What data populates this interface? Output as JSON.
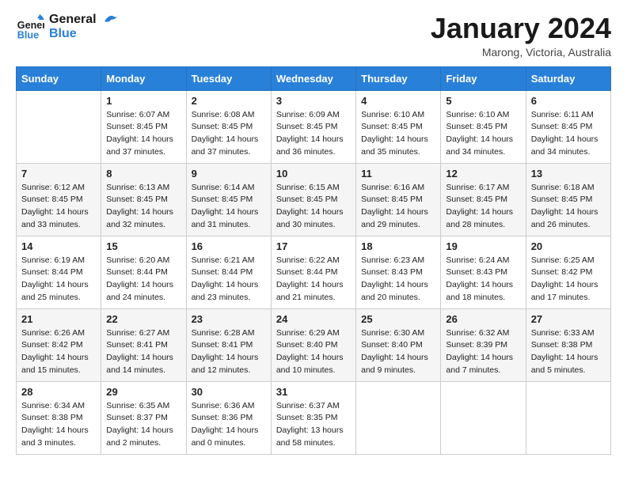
{
  "logo": {
    "line1": "General",
    "line2": "Blue"
  },
  "title": "January 2024",
  "subtitle": "Marong, Victoria, Australia",
  "headers": [
    "Sunday",
    "Monday",
    "Tuesday",
    "Wednesday",
    "Thursday",
    "Friday",
    "Saturday"
  ],
  "weeks": [
    [
      {
        "num": "",
        "detail": ""
      },
      {
        "num": "1",
        "detail": "Sunrise: 6:07 AM\nSunset: 8:45 PM\nDaylight: 14 hours\nand 37 minutes."
      },
      {
        "num": "2",
        "detail": "Sunrise: 6:08 AM\nSunset: 8:45 PM\nDaylight: 14 hours\nand 37 minutes."
      },
      {
        "num": "3",
        "detail": "Sunrise: 6:09 AM\nSunset: 8:45 PM\nDaylight: 14 hours\nand 36 minutes."
      },
      {
        "num": "4",
        "detail": "Sunrise: 6:10 AM\nSunset: 8:45 PM\nDaylight: 14 hours\nand 35 minutes."
      },
      {
        "num": "5",
        "detail": "Sunrise: 6:10 AM\nSunset: 8:45 PM\nDaylight: 14 hours\nand 34 minutes."
      },
      {
        "num": "6",
        "detail": "Sunrise: 6:11 AM\nSunset: 8:45 PM\nDaylight: 14 hours\nand 34 minutes."
      }
    ],
    [
      {
        "num": "7",
        "detail": "Sunrise: 6:12 AM\nSunset: 8:45 PM\nDaylight: 14 hours\nand 33 minutes."
      },
      {
        "num": "8",
        "detail": "Sunrise: 6:13 AM\nSunset: 8:45 PM\nDaylight: 14 hours\nand 32 minutes."
      },
      {
        "num": "9",
        "detail": "Sunrise: 6:14 AM\nSunset: 8:45 PM\nDaylight: 14 hours\nand 31 minutes."
      },
      {
        "num": "10",
        "detail": "Sunrise: 6:15 AM\nSunset: 8:45 PM\nDaylight: 14 hours\nand 30 minutes."
      },
      {
        "num": "11",
        "detail": "Sunrise: 6:16 AM\nSunset: 8:45 PM\nDaylight: 14 hours\nand 29 minutes."
      },
      {
        "num": "12",
        "detail": "Sunrise: 6:17 AM\nSunset: 8:45 PM\nDaylight: 14 hours\nand 28 minutes."
      },
      {
        "num": "13",
        "detail": "Sunrise: 6:18 AM\nSunset: 8:45 PM\nDaylight: 14 hours\nand 26 minutes."
      }
    ],
    [
      {
        "num": "14",
        "detail": "Sunrise: 6:19 AM\nSunset: 8:44 PM\nDaylight: 14 hours\nand 25 minutes."
      },
      {
        "num": "15",
        "detail": "Sunrise: 6:20 AM\nSunset: 8:44 PM\nDaylight: 14 hours\nand 24 minutes."
      },
      {
        "num": "16",
        "detail": "Sunrise: 6:21 AM\nSunset: 8:44 PM\nDaylight: 14 hours\nand 23 minutes."
      },
      {
        "num": "17",
        "detail": "Sunrise: 6:22 AM\nSunset: 8:44 PM\nDaylight: 14 hours\nand 21 minutes."
      },
      {
        "num": "18",
        "detail": "Sunrise: 6:23 AM\nSunset: 8:43 PM\nDaylight: 14 hours\nand 20 minutes."
      },
      {
        "num": "19",
        "detail": "Sunrise: 6:24 AM\nSunset: 8:43 PM\nDaylight: 14 hours\nand 18 minutes."
      },
      {
        "num": "20",
        "detail": "Sunrise: 6:25 AM\nSunset: 8:42 PM\nDaylight: 14 hours\nand 17 minutes."
      }
    ],
    [
      {
        "num": "21",
        "detail": "Sunrise: 6:26 AM\nSunset: 8:42 PM\nDaylight: 14 hours\nand 15 minutes."
      },
      {
        "num": "22",
        "detail": "Sunrise: 6:27 AM\nSunset: 8:41 PM\nDaylight: 14 hours\nand 14 minutes."
      },
      {
        "num": "23",
        "detail": "Sunrise: 6:28 AM\nSunset: 8:41 PM\nDaylight: 14 hours\nand 12 minutes."
      },
      {
        "num": "24",
        "detail": "Sunrise: 6:29 AM\nSunset: 8:40 PM\nDaylight: 14 hours\nand 10 minutes."
      },
      {
        "num": "25",
        "detail": "Sunrise: 6:30 AM\nSunset: 8:40 PM\nDaylight: 14 hours\nand 9 minutes."
      },
      {
        "num": "26",
        "detail": "Sunrise: 6:32 AM\nSunset: 8:39 PM\nDaylight: 14 hours\nand 7 minutes."
      },
      {
        "num": "27",
        "detail": "Sunrise: 6:33 AM\nSunset: 8:38 PM\nDaylight: 14 hours\nand 5 minutes."
      }
    ],
    [
      {
        "num": "28",
        "detail": "Sunrise: 6:34 AM\nSunset: 8:38 PM\nDaylight: 14 hours\nand 3 minutes."
      },
      {
        "num": "29",
        "detail": "Sunrise: 6:35 AM\nSunset: 8:37 PM\nDaylight: 14 hours\nand 2 minutes."
      },
      {
        "num": "30",
        "detail": "Sunrise: 6:36 AM\nSunset: 8:36 PM\nDaylight: 14 hours\nand 0 minutes."
      },
      {
        "num": "31",
        "detail": "Sunrise: 6:37 AM\nSunset: 8:35 PM\nDaylight: 13 hours\nand 58 minutes."
      },
      {
        "num": "",
        "detail": ""
      },
      {
        "num": "",
        "detail": ""
      },
      {
        "num": "",
        "detail": ""
      }
    ]
  ]
}
